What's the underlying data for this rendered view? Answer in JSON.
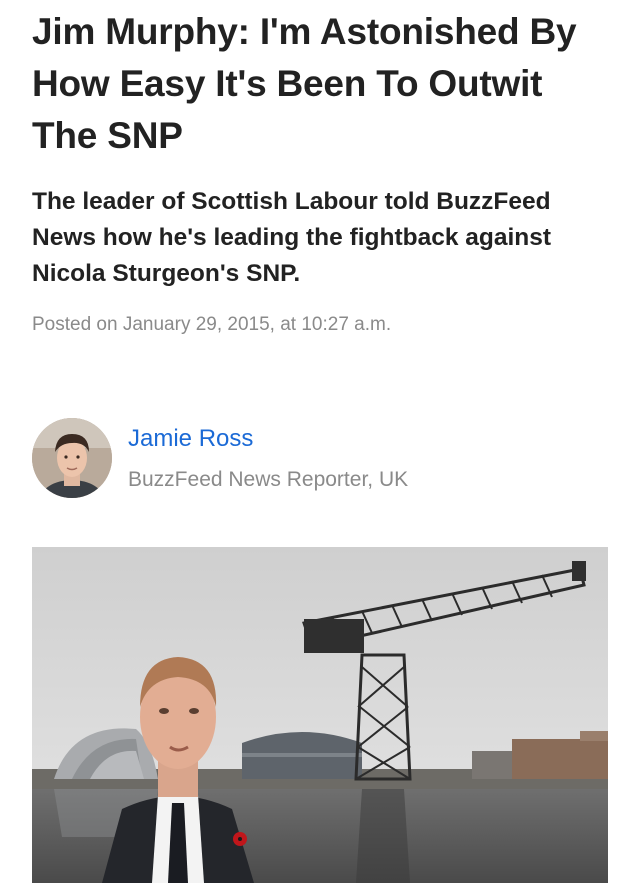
{
  "article": {
    "headline": "Jim Murphy: I'm Astonished By How Easy It's Been To Outwit The SNP",
    "dek": "The leader of Scottish Labour told BuzzFeed News how he's leading the fightback against Nicola Sturgeon's SNP.",
    "posted": "Posted on January 29, 2015, at 10:27 a.m."
  },
  "author": {
    "name": "Jamie Ross",
    "title": "BuzzFeed News Reporter, UK",
    "avatar_icon": "author-avatar-photo"
  },
  "hero": {
    "image_icon": "article-hero-photo"
  },
  "colors": {
    "text": "#222222",
    "meta": "#8a8a8a",
    "link": "#1b6ad6",
    "background": "#ffffff"
  }
}
